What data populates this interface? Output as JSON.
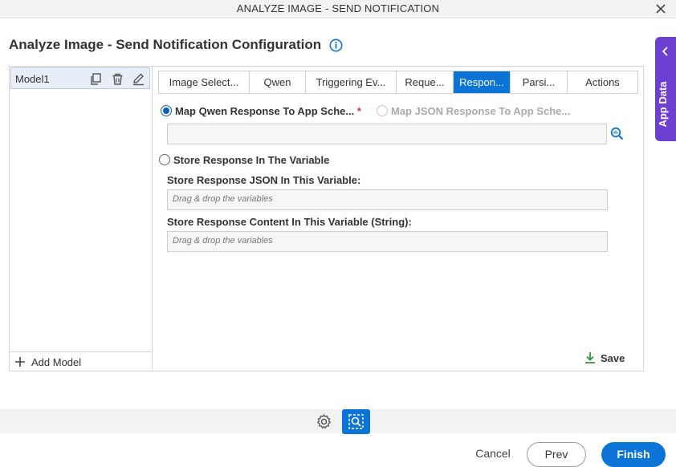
{
  "window": {
    "title": "ANALYZE IMAGE - SEND NOTIFICATION"
  },
  "page": {
    "heading": "Analyze Image - Send Notification Configuration"
  },
  "app_data": {
    "label": "App Data"
  },
  "models": {
    "items": [
      {
        "name": "Model1"
      }
    ],
    "add_label": "Add Model"
  },
  "tabs": [
    {
      "label": "Image Select..."
    },
    {
      "label": "Qwen"
    },
    {
      "label": "Triggering Ev..."
    },
    {
      "label": "Reque..."
    },
    {
      "label": "Respon...",
      "active": true
    },
    {
      "label": "Parsi..."
    },
    {
      "label": "Actions"
    }
  ],
  "response": {
    "map_option_label": "Map Qwen Response To App Sche...",
    "required_mark": "*",
    "json_option_label": "Map JSON Response To App Sche...",
    "store_option_label": "Store Response In The Variable",
    "json_var_label": "Store Response JSON In This Variable:",
    "json_var_placeholder": "Drag & drop the variables",
    "content_var_label": "Store Response Content In This Variable (String):",
    "content_var_placeholder": "Drag & drop the variables",
    "save_label": "Save"
  },
  "footer": {
    "cancel_label": "Cancel",
    "prev_label": "Prev",
    "finish_label": "Finish"
  },
  "colors": {
    "accent": "#0b74d6",
    "app_data": "#6d3fd0",
    "required": "#d63a3a"
  }
}
